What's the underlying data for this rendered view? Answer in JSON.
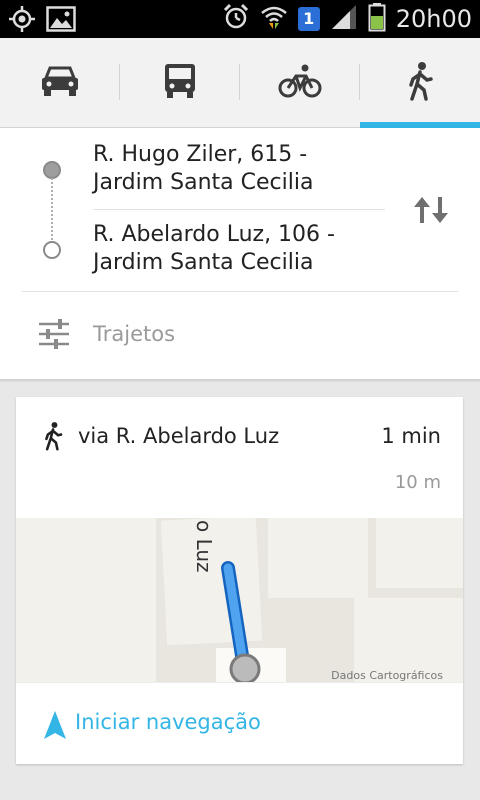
{
  "status_bar": {
    "time": "20h00",
    "notification_badge": "1",
    "icons": [
      "gps-icon",
      "image-icon",
      "alarm-icon",
      "wifi-icon",
      "notification-badge",
      "signal-icon",
      "battery-icon"
    ]
  },
  "modes": {
    "items": [
      {
        "name": "car",
        "icon": "car-icon",
        "active": false
      },
      {
        "name": "transit",
        "icon": "bus-icon",
        "active": false
      },
      {
        "name": "bike",
        "icon": "bike-icon",
        "active": false
      },
      {
        "name": "walk",
        "icon": "walk-icon",
        "active": true
      }
    ],
    "accent_color": "#33b5e5"
  },
  "route": {
    "from": "R. Hugo Ziler, 615 - Jardim Santa Cecilia",
    "to": "R. Abelardo Luz, 106 - Jardim Santa Cecilia",
    "options_label": "Trajetos"
  },
  "result": {
    "via": "via R. Abelardo Luz",
    "duration": "1 min",
    "distance": "10 m",
    "map_street_label": "o Luz",
    "map_copyright": "Dados Cartográficos",
    "start_navigation": "Iniciar navegação"
  }
}
